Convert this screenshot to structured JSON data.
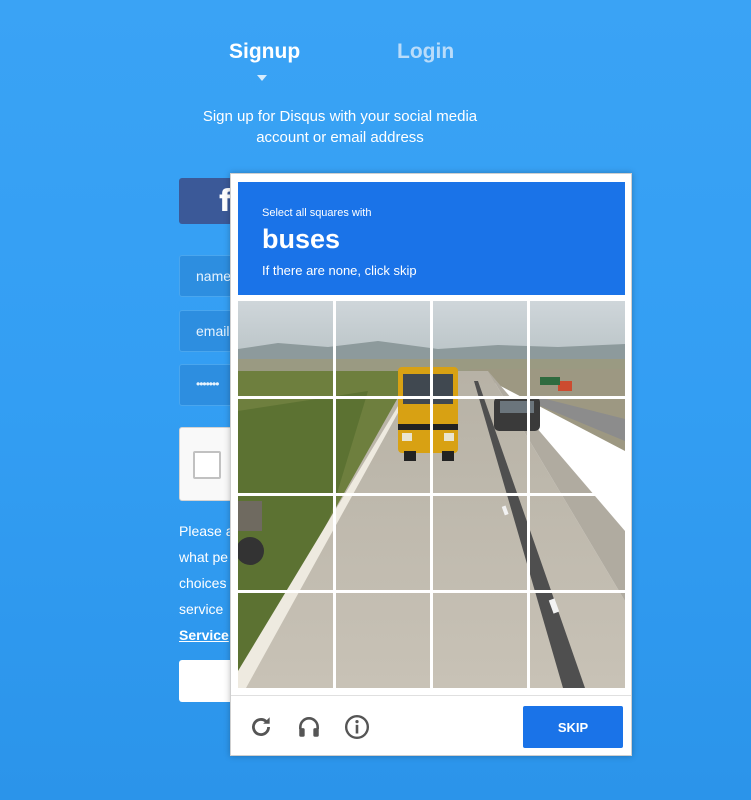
{
  "tabs": {
    "signup": "Signup",
    "login": "Login"
  },
  "subtitle": {
    "line1": "Sign up for Disqus with your social media",
    "line2": "account or email address"
  },
  "social": {
    "facebook_glyph": "f"
  },
  "form": {
    "name_placeholder": "name",
    "email_placeholder": "email",
    "password_value": "•••••••"
  },
  "policy": {
    "lines": [
      "Please a",
      "what pe",
      "choices",
      "service "
    ],
    "link": "Service"
  },
  "captcha": {
    "instruction": "Select all squares with",
    "target": "buses",
    "hint": "If there are none, click skip",
    "skip_label": "SKIP",
    "icons": [
      "reload-icon",
      "audio-icon",
      "info-icon"
    ],
    "accent_color": "#1a73e8",
    "grid": {
      "rows": 4,
      "cols": 4
    }
  }
}
